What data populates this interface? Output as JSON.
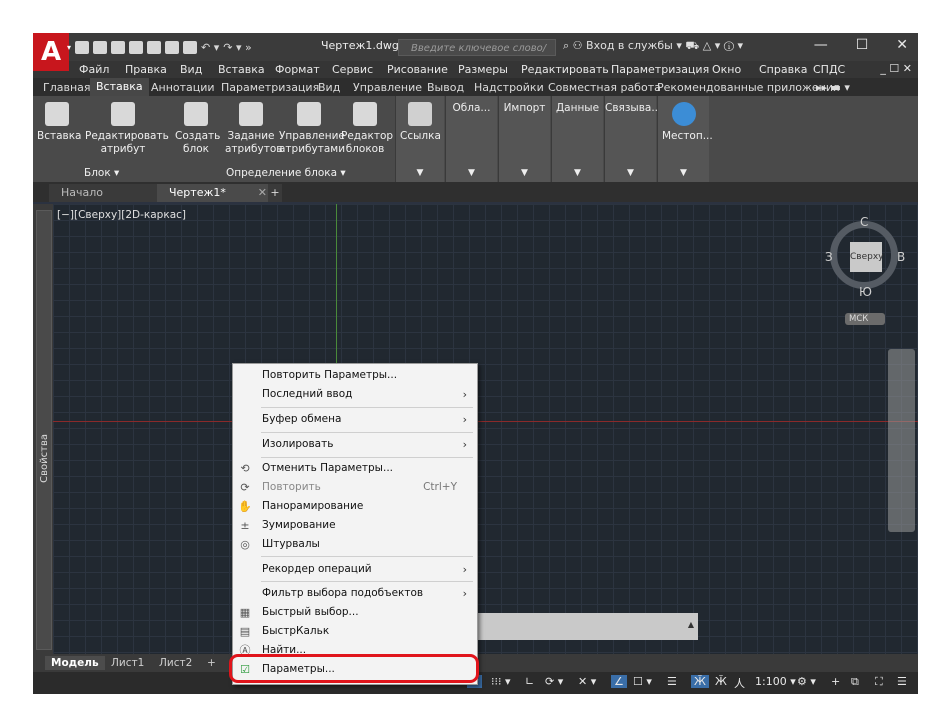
{
  "app": {
    "logo_letter": "A",
    "doc_title": "Чертеж1.dwg",
    "search_placeholder": "Введите ключевое слово/фразу",
    "signin": "Вход в службы",
    "win_controls": {
      "minimize": "—",
      "maximize": "☐",
      "close": "✕"
    }
  },
  "menubar": {
    "items": [
      "Файл",
      "Правка",
      "Вид",
      "Вставка",
      "Формат",
      "Сервис",
      "Рисование",
      "Размеры",
      "Редактировать",
      "Параметризация",
      "Окно",
      "Справка",
      "СПДС"
    ],
    "right_controls": "_ ☐ ✕"
  },
  "ribbon_tabs": {
    "items": [
      "Главная",
      "Вставка",
      "Аннотации",
      "Параметризация",
      "Вид",
      "Управление",
      "Вывод",
      "Надстройки",
      "Совместная работа",
      "Рекомендованные приложения"
    ],
    "active_index": 1,
    "more": "▸▸ ▬ ▾"
  },
  "ribbon": {
    "buttons": {
      "insert": "Вставка",
      "edit_attr": "Редактировать\nатрибут",
      "create_block": "Создать\nблок",
      "define_attr": "Задание\nатрибутов",
      "manage_attr": "Управление\nатрибутами",
      "block_editor": "Редактор\nблоков",
      "link": "Ссылка",
      "cloud": "Обла...",
      "import": "Импорт",
      "data": "Данные",
      "linking": "Связыва...",
      "location": "Местоп..."
    },
    "panels": {
      "block": "Блок ▾",
      "block_def": "Определение блока ▾"
    }
  },
  "file_tabs": {
    "start": "Начало",
    "current": "Чертеж1*",
    "close": "✕",
    "plus": "+"
  },
  "viewport": {
    "label": "[−][Сверху][2D-каркас]",
    "properties": "Свойства",
    "viewcube": {
      "top": "С",
      "bottom": "Ю",
      "left": "З",
      "right": "В",
      "face": "Сверху",
      "ucs": "МСК"
    }
  },
  "layout_tabs": [
    "Модель",
    "Лист1",
    "Лист2",
    "+"
  ],
  "status": {
    "scale": "1:100"
  },
  "context_menu": {
    "items": [
      {
        "label": "Повторить Параметры...",
        "icon": "",
        "shortcut": "",
        "submenu": false,
        "disabled": false
      },
      {
        "label": "Последний ввод",
        "icon": "",
        "shortcut": "",
        "submenu": true,
        "disabled": false
      },
      {
        "label": "Буфер обмена",
        "icon": "",
        "shortcut": "",
        "submenu": true,
        "disabled": false
      },
      {
        "label": "Изолировать",
        "icon": "",
        "shortcut": "",
        "submenu": true,
        "disabled": false
      },
      {
        "label": "Отменить Параметры...",
        "icon": "⟲",
        "shortcut": "",
        "submenu": false,
        "disabled": false
      },
      {
        "label": "Повторить",
        "icon": "⟳",
        "shortcut": "Ctrl+Y",
        "submenu": false,
        "disabled": true
      },
      {
        "label": "Панорамирование",
        "icon": "✋",
        "shortcut": "",
        "submenu": false,
        "disabled": false
      },
      {
        "label": "Зумирование",
        "icon": "±",
        "shortcut": "",
        "submenu": false,
        "disabled": false
      },
      {
        "label": "Штурвалы",
        "icon": "◎",
        "shortcut": "",
        "submenu": false,
        "disabled": false
      },
      {
        "label": "Рекордер операций",
        "icon": "",
        "shortcut": "",
        "submenu": true,
        "disabled": false
      },
      {
        "label": "Фильтр выбора подобъектов",
        "icon": "",
        "shortcut": "",
        "submenu": true,
        "disabled": false
      },
      {
        "label": "Быстрый выбор...",
        "icon": "▦",
        "shortcut": "",
        "submenu": false,
        "disabled": false
      },
      {
        "label": "БыстрКальк",
        "icon": "▤",
        "shortcut": "",
        "submenu": false,
        "disabled": false
      },
      {
        "label": "Найти...",
        "icon": "Ⓐ",
        "shortcut": "",
        "submenu": false,
        "disabled": false
      },
      {
        "label": "Параметры...",
        "icon": "☑",
        "shortcut": "",
        "submenu": false,
        "disabled": false
      }
    ],
    "highlight_color": "#e0141b"
  }
}
